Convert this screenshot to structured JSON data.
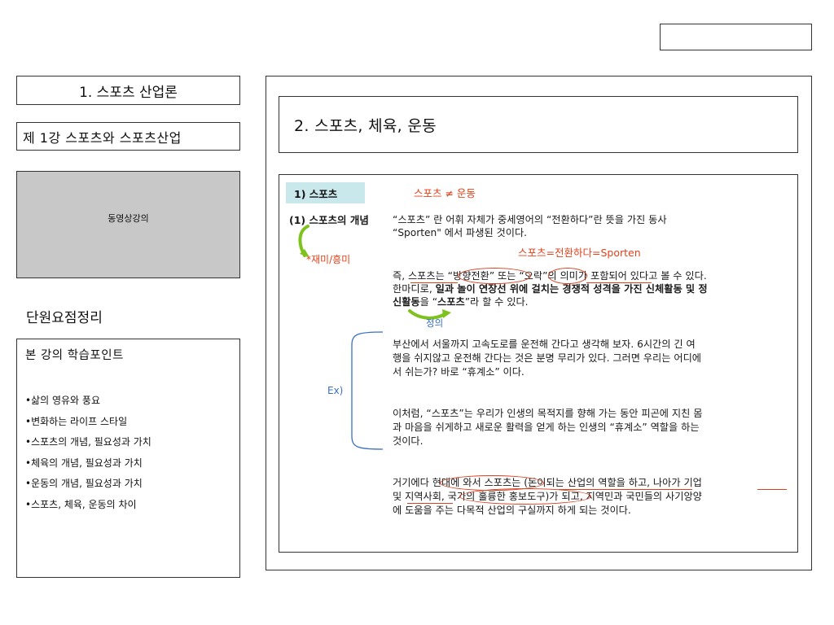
{
  "top_right_box": "",
  "sidebar": {
    "course_title": "1. 스포츠 산업론",
    "lecture_title": "제 1강 스포츠와 스포츠산업",
    "video_label": "동영상강의",
    "summary_heading": "단원요점정리",
    "points_title": "본 강의 학습포인트",
    "points": [
      "•삶의 영유와 풍요",
      "•변화하는 라이프 스타일",
      "•스포츠의 개념, 필요성과 가치",
      "•체육의 개념, 필요성과 가치",
      "•운동의 개념, 필요성과 가치",
      "•스포츠, 체육, 운동의 차이"
    ]
  },
  "main": {
    "section_title": "2. 스포츠, 체육, 운동",
    "tab_label": "1) 스포츠",
    "formula_top": "스포츠 ≠ 운동",
    "concept_label": "(1) 스포츠의 개념",
    "side_note": "*재미/흥미",
    "para1_line1": "“스포츠” 란 어휘 자체가 중세영어의 “전환하다”란 뜻을 가진 동사",
    "para1_line2": "“Sporten\" 에서 파생된 것이다.",
    "formula_mid": "스포츠=전환하다=Sporten",
    "para2_line1": "즉, 스포츠는 “방향전환” 또는 “오락”의 의미가 포함되어 있다고 볼 수 있다.",
    "para2_line2_a": "한마디로, ",
    "para2_line2_b": "일과 놀이 연장선 위에 걸치는 경쟁적 성격을 가진 신체활동 및 정",
    "para2_line3_a": "신활동",
    "para2_line3_b": "을 “",
    "para2_line3_c": "스포츠",
    "para2_line3_d": "”라 할 수 있다.",
    "definition_label": "정의",
    "ex_label": "Ex)",
    "para3_line1": " 부산에서 서울까지 고속도로를 운전해 간다고 생각해 보자. 6시간의 긴 여",
    "para3_line2": "행을 쉬지않고 운전해 간다는 것은 분명 무리가 있다. 그러면 우리는 어디에",
    "para3_line3": "서 쉬는가? 바로 “휴계소” 이다.",
    "para4_line1": "이처럼, “스포츠”는 우리가 인생의 목적지를 향해 가는 동안 피곤에 지친 몸",
    "para4_line2": "과 마음을 쉬게하고 새로운 활력을 얻게 하는 인생의 “휴계소” 역할을 하는",
    "para4_line3": "것이다.",
    "para5_line1": "거기에다 현대에 와서 스포츠는 (돈이되는 산업의 역할을 하고, 나아가 기업",
    "para5_line2": "및 지역사회, 국가의 훌륭한 홍보도구)가 되고, 지역민과 국민들의 사기앙양",
    "para5_line3": "에 도움을 주는 다목적 산업의 구실까지 하게 되는 것이다."
  },
  "colors": {
    "accent_red": "#e0431c",
    "accent_blue": "#3a6fc4",
    "tab_bg": "#c9e8ec",
    "video_bg": "#c8c8c8",
    "arrow_green": "#7ec21d"
  }
}
